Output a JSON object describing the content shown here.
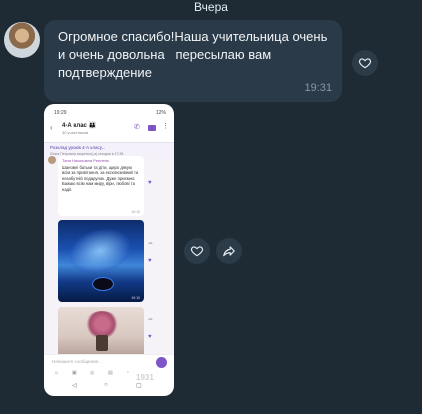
{
  "date_separator": "Вчера",
  "message": {
    "text": "Огромное спасибо!Наша учительница очень\nи очень довольна   пересылаю вам\nподтверждение",
    "time": "19:31"
  },
  "screenshot": {
    "status_time": "19:29",
    "status_right": "12%",
    "chat_title": "4-А клас 👪",
    "chat_subtitle": "30 участников",
    "pinned_title": "Розклад уроків 4-А класу...",
    "pinned_sub": "Юлия Петровна закрепил(-а) сегодня в 17:38",
    "sender": "Таня Никоновна Реплень",
    "message_text": "Шановні батьки та діти, щиро дякую всім за привітання, за ексклюзивний та незабутній подарунок. Дуже приємно. Бажаю всім нам миру, віри, любові та надії.",
    "msg_time": "19:10",
    "photo_time": "19:10",
    "input_placeholder": "Напишите сообщение...",
    "watermark": "1931"
  },
  "colors": {
    "background": "#1e2a34",
    "bubble": "#2a3a48",
    "accent": "#7d55c7"
  },
  "icons": [
    "heart-icon",
    "share-icon"
  ]
}
